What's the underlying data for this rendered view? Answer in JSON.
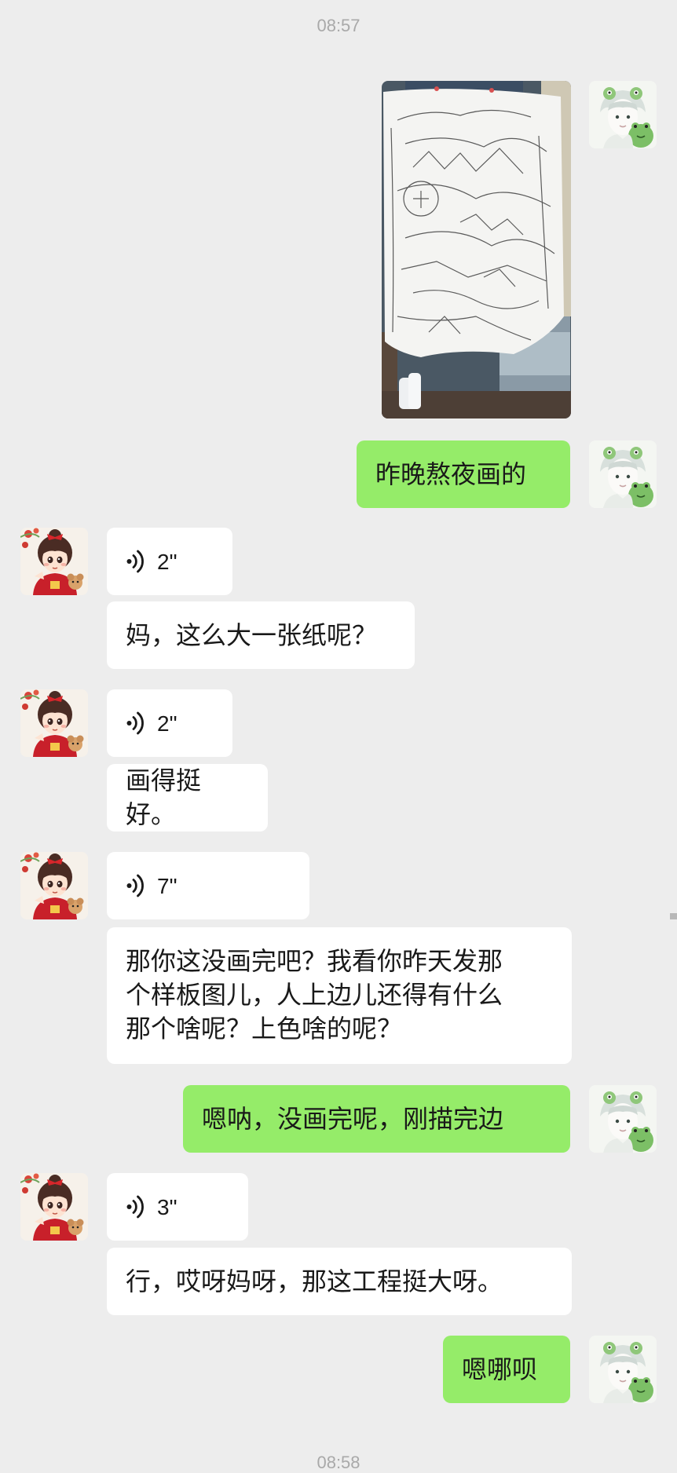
{
  "chat": {
    "timestamp_top": "08:57",
    "timestamp_bottom": "08:58"
  },
  "messages": {
    "m1": {
      "sender": "me",
      "type": "image",
      "icon": "photo-of-hand-drawn-poster"
    },
    "m2": {
      "sender": "me",
      "type": "text",
      "text": "昨晚熬夜画的"
    },
    "m3": {
      "sender": "mom",
      "type": "voice",
      "duration": "2\""
    },
    "m4": {
      "sender": "mom",
      "type": "text",
      "text": "妈，这么大一张纸呢？"
    },
    "m5": {
      "sender": "mom",
      "type": "voice",
      "duration": "2\""
    },
    "m6": {
      "sender": "mom",
      "type": "text",
      "text": "画得挺好。"
    },
    "m7": {
      "sender": "mom",
      "type": "voice",
      "duration": "7\""
    },
    "m8": {
      "sender": "mom",
      "type": "text",
      "text": "那你这没画完吧？我看你昨天发那\n个样板图儿，人上边儿还得有什么\n那个啥呢？上色啥的呢？"
    },
    "m9": {
      "sender": "me",
      "type": "text",
      "text": "嗯呐，没画完呢，刚描完边"
    },
    "m10": {
      "sender": "mom",
      "type": "voice",
      "duration": "3\""
    },
    "m11": {
      "sender": "mom",
      "type": "text",
      "text": "行，哎呀妈呀，那这工程挺大呀。"
    },
    "m12": {
      "sender": "me",
      "type": "text",
      "text": "嗯哪呗"
    }
  },
  "colors": {
    "background": "#ededed",
    "bubble_in": "#ffffff",
    "bubble_out": "#95ec69",
    "timestamp": "#a9a9a9"
  }
}
